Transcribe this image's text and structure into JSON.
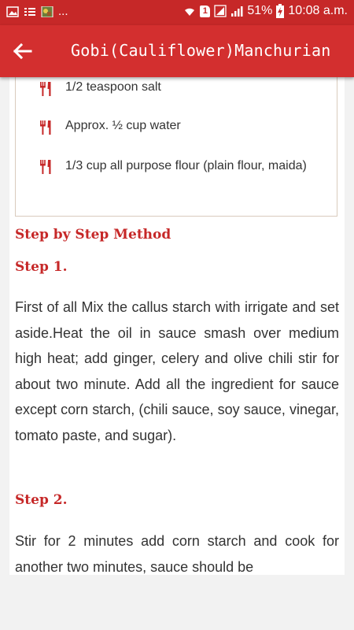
{
  "status_bar": {
    "battery_percent": "51%",
    "time": "10:08 a.m.",
    "overflow": "...",
    "sim_badge": "1"
  },
  "app_bar": {
    "title": "Gobi(Cauliflower)Manchurian"
  },
  "ingredients": [
    "1/2 teaspoon salt",
    "Approx. ½ cup water",
    "1/3 cup all purpose flour (plain flour, maida)"
  ],
  "method": {
    "heading": "Step by Step Method",
    "steps": [
      {
        "title": "Step 1.",
        "text": "First of all Mix the callus starch with irrigate and set aside.Heat the oil in sauce smash over medium high heat; add ginger, celery and olive chili stir for about two minute. Add all the ingredient for sauce except corn starch, (chili sauce, soy sauce, vinegar, tomato paste, and sugar)."
      },
      {
        "title": "Step 2.",
        "text": "Stir for 2 minutes add corn starch and cook for another two minutes, sauce should be"
      }
    ]
  },
  "colors": {
    "app_bar": "#d32f2f",
    "status_bar": "#c62828",
    "accent": "#c62828",
    "body_text": "#333333"
  }
}
